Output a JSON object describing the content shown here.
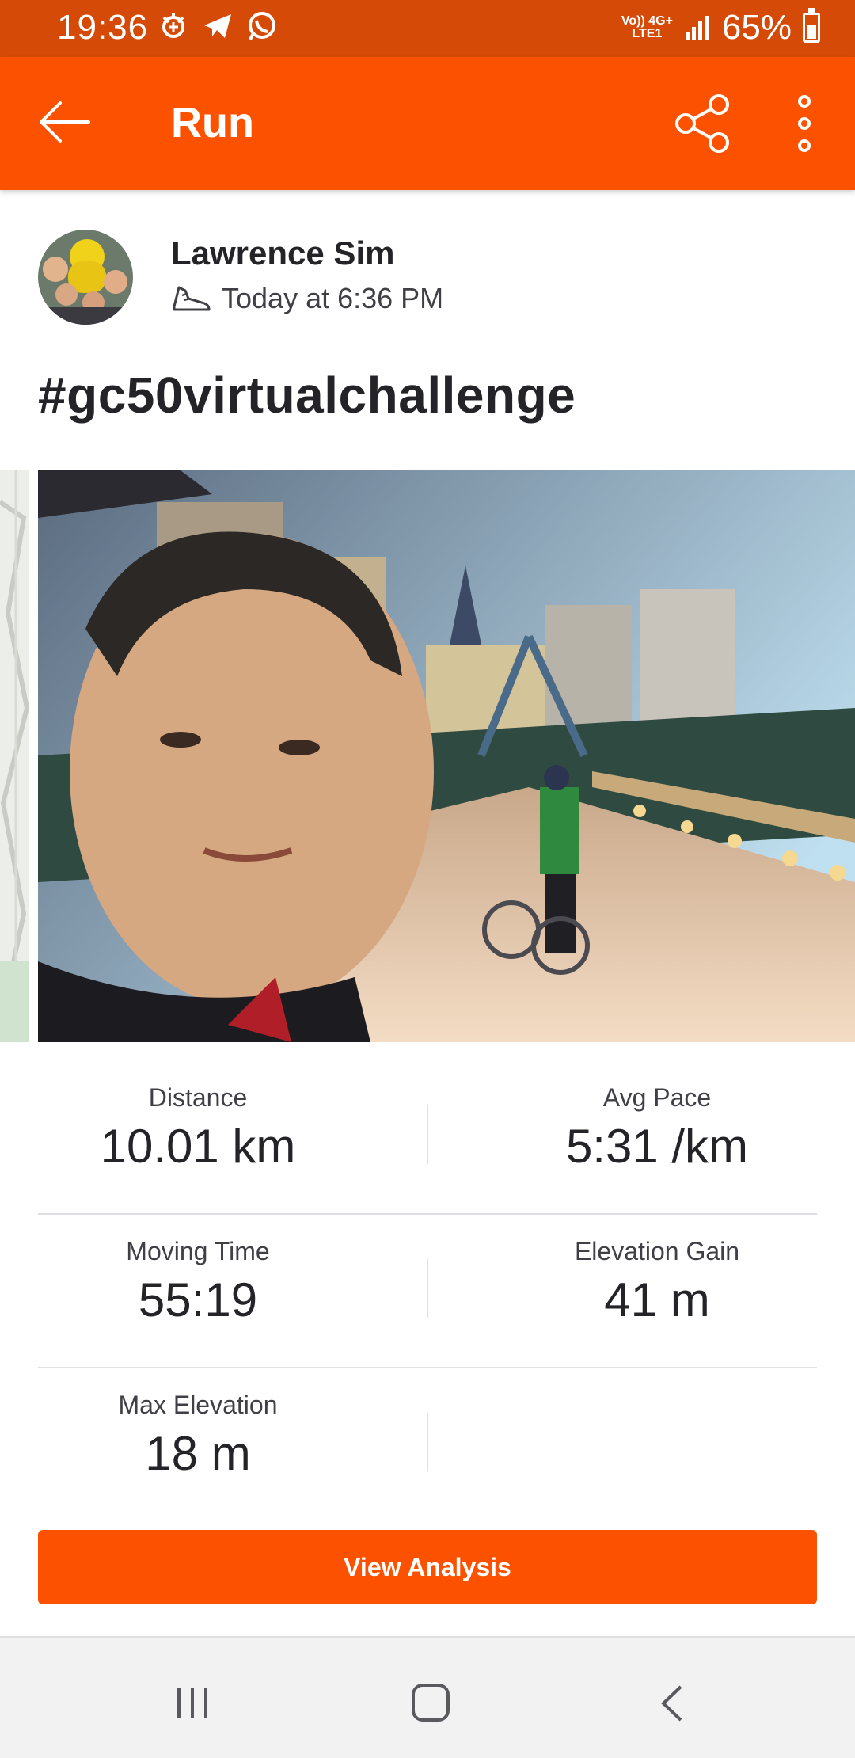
{
  "status_bar": {
    "time": "19:36",
    "battery": "65%",
    "battery_level": 0.65,
    "network_top": "Vo)) 4G+",
    "network_bottom": "LTE1",
    "icons": [
      "signal-icon",
      "telegram-icon",
      "whatsapp-icon"
    ]
  },
  "app_bar": {
    "title": "Run",
    "icons": [
      "back-arrow-icon",
      "share-icon",
      "more-vert-icon"
    ]
  },
  "activity": {
    "athlete_name": "Lawrence Sim",
    "timestamp": "Today at 6:36 PM",
    "type_icon": "run-shoe-icon",
    "title": "#gc50virtualchallenge"
  },
  "stats": {
    "distance": {
      "label": "Distance",
      "value": "10.01 km"
    },
    "avg_pace": {
      "label": "Avg Pace",
      "value": "5:31 /km"
    },
    "moving_time": {
      "label": "Moving Time",
      "value": "55:19"
    },
    "elevation_gain": {
      "label": "Elevation Gain",
      "value": "41 m"
    },
    "max_elevation": {
      "label": "Max Elevation",
      "value": "18 m"
    }
  },
  "actions": {
    "view_analysis": "View Analysis"
  },
  "colors": {
    "brand": "#fc5200",
    "status_bar": "#d64a08",
    "text": "#242428"
  }
}
